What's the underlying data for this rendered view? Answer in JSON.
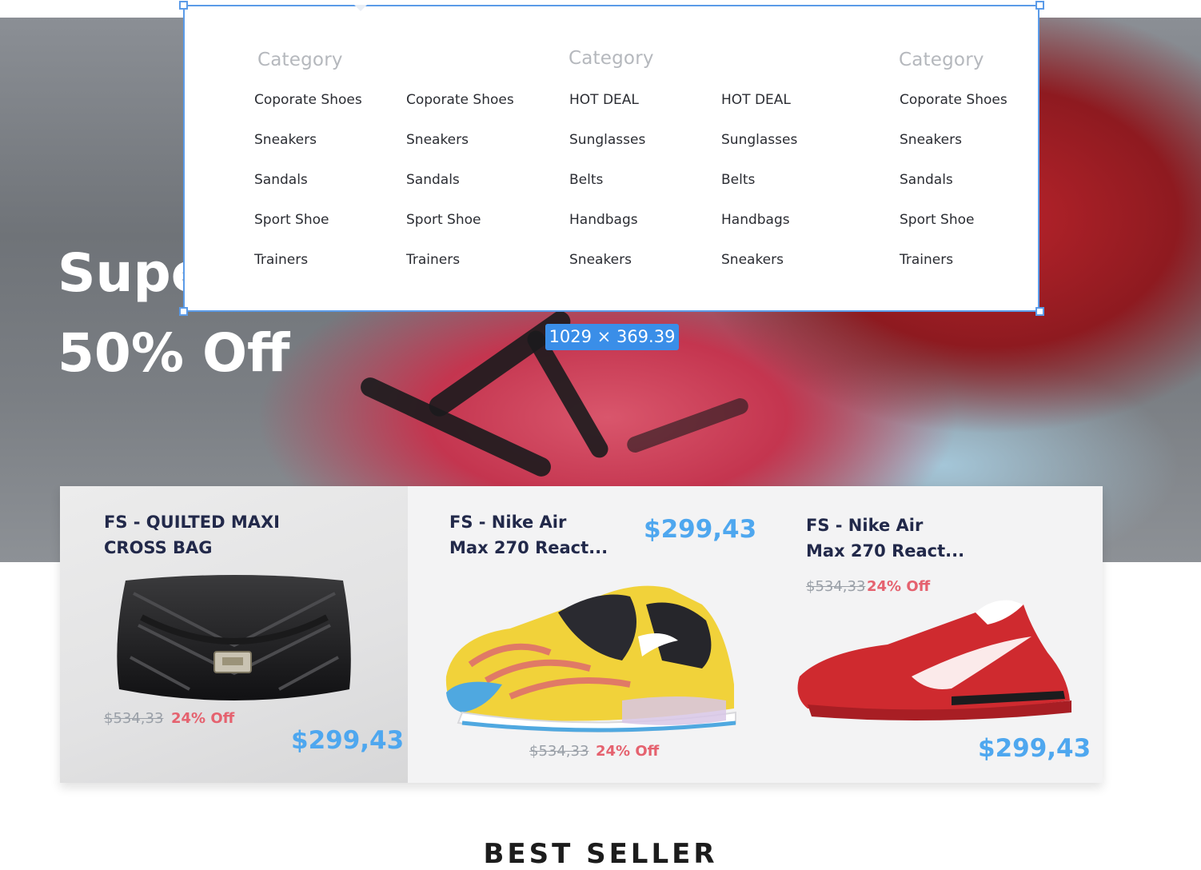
{
  "hero": {
    "title": "Supe",
    "subtitle": "50% Off"
  },
  "mega_menu": {
    "columns": [
      {
        "heading": "Category",
        "items": [
          "Coporate Shoes",
          "Sneakers",
          "Sandals",
          "Sport Shoe",
          "Trainers"
        ]
      },
      {
        "heading": "",
        "items": [
          "Coporate Shoes",
          "Sneakers",
          "Sandals",
          "Sport Shoe",
          "Trainers"
        ]
      },
      {
        "heading": "Category",
        "items": [
          "HOT DEAL",
          "Sunglasses",
          "Belts",
          "Handbags",
          "Sneakers"
        ]
      },
      {
        "heading": "",
        "items": [
          "HOT DEAL",
          "Sunglasses",
          "Belts",
          "Handbags",
          "Sneakers"
        ]
      },
      {
        "heading": "Category",
        "items": [
          "Coporate Shoes",
          "Sneakers",
          "Sandals",
          "Sport Shoe",
          "Trainers"
        ]
      }
    ],
    "size_badge": "1029 × 369.39"
  },
  "products": [
    {
      "title_line1": "FS - QUILTED MAXI",
      "title_line2": "CROSS BAG",
      "old_price": "$534,33",
      "discount": "24% Off",
      "price": "$299,43",
      "image_icon": "black-quilted-bag"
    },
    {
      "title_line1": "FS - Nike Air",
      "title_line2": "Max 270 React...",
      "old_price": "$534,33",
      "discount": "24% Off",
      "price": "$299,43",
      "image_icon": "multicolor-sneaker"
    },
    {
      "title_line1": "FS - Nike Air",
      "title_line2": "Max 270 React...",
      "old_price": "$534,33",
      "discount": "24% Off",
      "price": "$299,43",
      "image_icon": "red-running-shoe"
    }
  ],
  "section": {
    "best_seller": "BEST SELLER"
  },
  "colors": {
    "accent_blue": "#4ea7ef",
    "discount_red": "#e5626f",
    "selection_blue": "#5b9be8",
    "title_navy": "#22294a"
  }
}
